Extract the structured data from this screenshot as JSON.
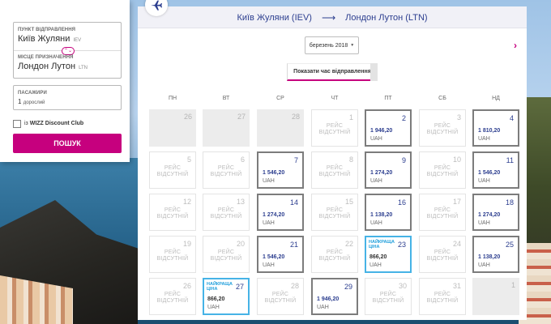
{
  "search": {
    "from_label": "ПУНКТ ВІДПРАВЛЕННЯ",
    "from_value": "Київ Жуляни",
    "from_code": "IEV",
    "to_label": "МІСЦЕ ПРИЗНАЧЕННЯ",
    "to_value": "Лондон Лутон",
    "to_code": "LTN",
    "swap_icon": "⌃⌄",
    "pax_label": "ПАСАЖИРИ",
    "pax_value": "1",
    "pax_unit": "дорослий",
    "club_prefix": "із",
    "club_name": "WIZZ Discount Club",
    "search_button": "ПОШУК"
  },
  "calendar": {
    "origin": "Київ Жуляни (IEV)",
    "arrow": "⟶",
    "destination": "Лондон Лутон (LTN)",
    "month": "березень 2018",
    "month_caret": "▼",
    "next_icon": "›",
    "show_times": "Показати час відправлення",
    "weekdays": [
      "ПН",
      "ВТ",
      "СР",
      "ЧТ",
      "ПТ",
      "СБ",
      "НД"
    ],
    "no_flight_line1": "РЕЙС",
    "no_flight_line2": "ВІДСУТНІЙ",
    "best_badge_line1": "НАЙКРАЩА",
    "best_badge_line2": "ЦІНА",
    "days": [
      {
        "d": "26",
        "s": "past"
      },
      {
        "d": "27",
        "s": "past"
      },
      {
        "d": "28",
        "s": "past"
      },
      {
        "d": "1",
        "s": "none"
      },
      {
        "d": "2",
        "s": "flight",
        "p": "1 946,20",
        "c": "UAH"
      },
      {
        "d": "3",
        "s": "none"
      },
      {
        "d": "4",
        "s": "flight",
        "p": "1 810,20",
        "c": "UAH"
      },
      {
        "d": "5",
        "s": "none"
      },
      {
        "d": "6",
        "s": "none"
      },
      {
        "d": "7",
        "s": "flight",
        "p": "1 546,20",
        "c": "UAH"
      },
      {
        "d": "8",
        "s": "none"
      },
      {
        "d": "9",
        "s": "flight",
        "p": "1 274,20",
        "c": "UAH"
      },
      {
        "d": "10",
        "s": "none"
      },
      {
        "d": "11",
        "s": "flight",
        "p": "1 546,20",
        "c": "UAH"
      },
      {
        "d": "12",
        "s": "none"
      },
      {
        "d": "13",
        "s": "none"
      },
      {
        "d": "14",
        "s": "flight",
        "p": "1 274,20",
        "c": "UAH"
      },
      {
        "d": "15",
        "s": "none"
      },
      {
        "d": "16",
        "s": "flight",
        "p": "1 138,20",
        "c": "UAH"
      },
      {
        "d": "17",
        "s": "none"
      },
      {
        "d": "18",
        "s": "flight",
        "p": "1 274,20",
        "c": "UAH"
      },
      {
        "d": "19",
        "s": "none"
      },
      {
        "d": "20",
        "s": "none"
      },
      {
        "d": "21",
        "s": "flight",
        "p": "1 546,20",
        "c": "UAH"
      },
      {
        "d": "22",
        "s": "none"
      },
      {
        "d": "23",
        "s": "best",
        "p": "866,20",
        "c": "UAH"
      },
      {
        "d": "24",
        "s": "none"
      },
      {
        "d": "25",
        "s": "flight",
        "p": "1 138,20",
        "c": "UAH"
      },
      {
        "d": "26",
        "s": "none"
      },
      {
        "d": "27",
        "s": "best",
        "p": "866,20",
        "c": "UAH"
      },
      {
        "d": "28",
        "s": "none"
      },
      {
        "d": "29",
        "s": "flight",
        "p": "1 946,20",
        "c": "UAH"
      },
      {
        "d": "30",
        "s": "none"
      },
      {
        "d": "31",
        "s": "none"
      },
      {
        "d": "1",
        "s": "past"
      }
    ]
  }
}
